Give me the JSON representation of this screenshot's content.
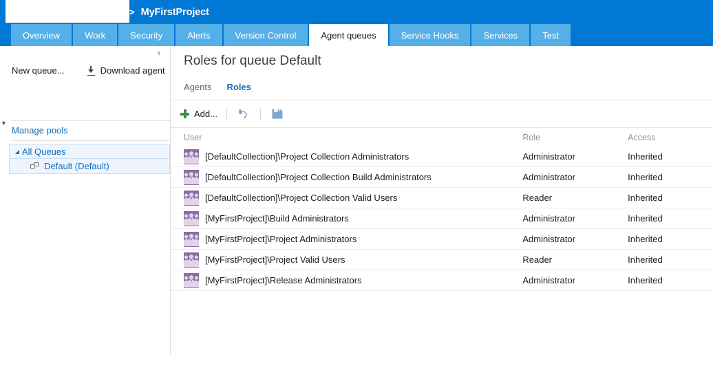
{
  "colors": {
    "header_blue": "#0078d4",
    "tab_blue": "#56b0e8",
    "link_blue": "#106ebe",
    "add_green": "#3f8f3a",
    "icon_blue": "#7fa8ce",
    "group_icon_bg": "#8a6f9e",
    "group_icon_fg": "#e0d4ea",
    "tree_selected_bg": "#eef5fd",
    "tree_selected_border": "#c9dff5"
  },
  "header": {
    "breadcrumb_separator": ">",
    "project_title": "MyFirstProject",
    "redacted_field_value": ""
  },
  "tabs": [
    {
      "label": "Overview",
      "active": false
    },
    {
      "label": "Work",
      "active": false
    },
    {
      "label": "Security",
      "active": false
    },
    {
      "label": "Alerts",
      "active": false
    },
    {
      "label": "Version Control",
      "active": false
    },
    {
      "label": "Agent queues",
      "active": true
    },
    {
      "label": "Service Hooks",
      "active": false
    },
    {
      "label": "Services",
      "active": false
    },
    {
      "label": "Test",
      "active": false
    }
  ],
  "left_pane": {
    "collapse_chevron": "‹",
    "outer_expander": "▼",
    "actions": [
      {
        "label": "New queue...",
        "icon": ""
      },
      {
        "label": "Download agent",
        "icon": "download-icon"
      }
    ],
    "manage_pools_label": "Manage pools",
    "tree": [
      {
        "label": "All Queues",
        "expander": "◢",
        "level": 0,
        "selected": true
      },
      {
        "label": "Default (Default)",
        "icon": "queue-icon",
        "level": 1,
        "selected": true
      }
    ]
  },
  "main": {
    "title": "Roles for queue Default",
    "pivots": [
      {
        "label": "Agents",
        "active": false
      },
      {
        "label": "Roles",
        "active": true
      }
    ],
    "toolbar": {
      "add_label": "Add...",
      "add_icon": "plus-icon",
      "undo_icon": "undo-arrow-icon",
      "save_icon": "save-disk-icon"
    },
    "grid": {
      "columns": [
        "User",
        "Role",
        "Access"
      ],
      "rows": [
        {
          "icon": "group-icon",
          "user": "[DefaultCollection]\\Project Collection Administrators",
          "role": "Administrator",
          "access": "Inherited"
        },
        {
          "icon": "group-icon",
          "user": "[DefaultCollection]\\Project Collection Build Administrators",
          "role": "Administrator",
          "access": "Inherited"
        },
        {
          "icon": "group-icon",
          "user": "[DefaultCollection]\\Project Collection Valid Users",
          "role": "Reader",
          "access": "Inherited"
        },
        {
          "icon": "group-icon",
          "user": "[MyFirstProject]\\Build Administrators",
          "role": "Administrator",
          "access": "Inherited"
        },
        {
          "icon": "group-icon",
          "user": "[MyFirstProject]\\Project Administrators",
          "role": "Administrator",
          "access": "Inherited"
        },
        {
          "icon": "group-icon",
          "user": "[MyFirstProject]\\Project Valid Users",
          "role": "Reader",
          "access": "Inherited"
        },
        {
          "icon": "group-icon",
          "user": "[MyFirstProject]\\Release Administrators",
          "role": "Administrator",
          "access": "Inherited"
        }
      ]
    }
  }
}
